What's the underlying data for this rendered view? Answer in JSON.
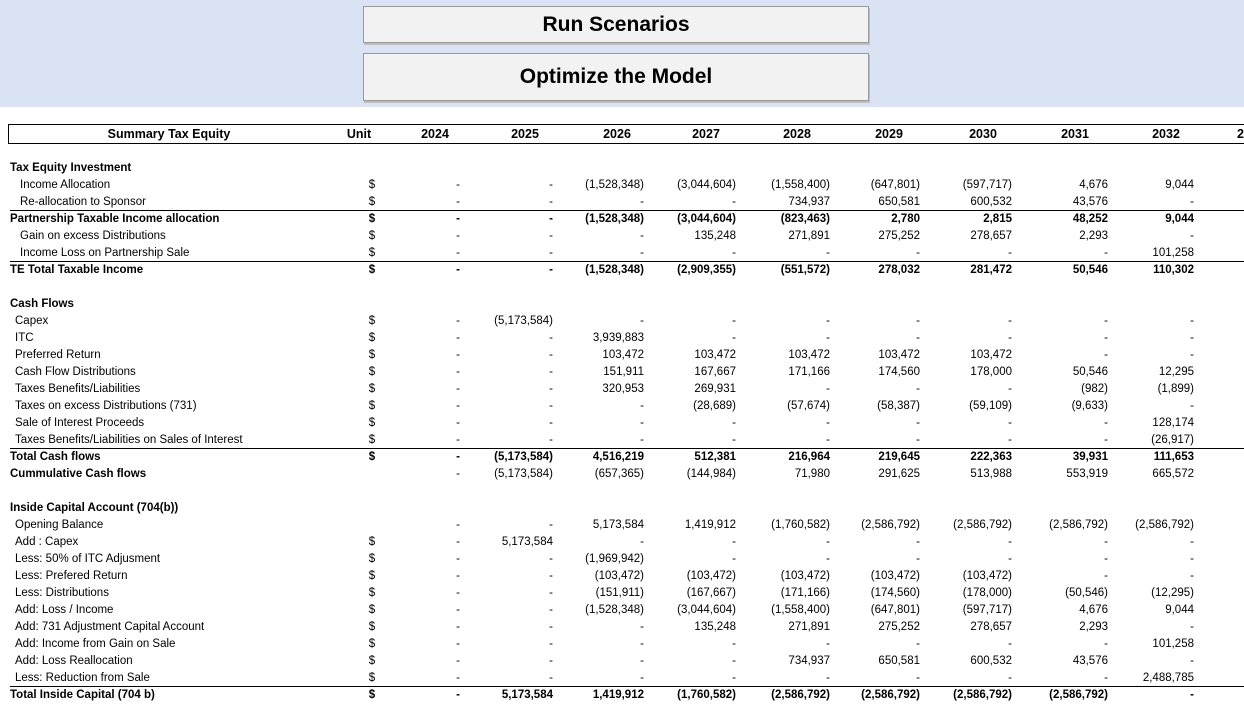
{
  "buttons": {
    "run": "Run Scenarios",
    "optimize": "Optimize the Model"
  },
  "header": {
    "title": "Summary Tax Equity",
    "unit": "Unit",
    "years": [
      "2024",
      "2025",
      "2026",
      "2027",
      "2028",
      "2029",
      "2030",
      "2031",
      "2032"
    ],
    "overflow_char": "2"
  },
  "rows": [
    {
      "label": "Tax Equity Investment",
      "unit": "",
      "vals": [
        "",
        "",
        "",
        "",
        "",
        "",
        "",
        "",
        ""
      ],
      "bold": true,
      "indent": 0
    },
    {
      "label": "Income Allocation",
      "unit": "$",
      "vals": [
        "-",
        "-",
        "(1,528,348)",
        "(3,044,604)",
        "(1,558,400)",
        "(647,801)",
        "(597,717)",
        "4,676",
        "9,044"
      ],
      "indent": 1
    },
    {
      "label": "Re-allocation to Sponsor",
      "unit": "$",
      "vals": [
        "-",
        "-",
        "-",
        "-",
        "734,937",
        "650,581",
        "600,532",
        "43,576",
        "-"
      ],
      "indent": 1
    },
    {
      "label": "Partnership Taxable Income allocation",
      "unit": "$",
      "vals": [
        "-",
        "-",
        "(1,528,348)",
        "(3,044,604)",
        "(823,463)",
        "2,780",
        "2,815",
        "48,252",
        "9,044"
      ],
      "bold": true,
      "line": true,
      "indent": 0
    },
    {
      "label": "Gain on excess Distributions",
      "unit": "$",
      "vals": [
        "-",
        "-",
        "-",
        "135,248",
        "271,891",
        "275,252",
        "278,657",
        "2,293",
        "-"
      ],
      "indent": 1
    },
    {
      "label": "Income Loss on Partnership Sale",
      "unit": "$",
      "vals": [
        "-",
        "-",
        "-",
        "-",
        "-",
        "-",
        "-",
        "-",
        "101,258"
      ],
      "indent": 1
    },
    {
      "label": "TE Total Taxable Income",
      "unit": "$",
      "vals": [
        "-",
        "-",
        "(1,528,348)",
        "(2,909,355)",
        "(551,572)",
        "278,032",
        "281,472",
        "50,546",
        "110,302"
      ],
      "bold": true,
      "line": true,
      "indent": 0
    },
    {
      "label": "",
      "unit": "",
      "vals": [
        "",
        "",
        "",
        "",
        "",
        "",
        "",
        "",
        ""
      ],
      "indent": 0
    },
    {
      "label": "Cash Flows",
      "unit": "",
      "vals": [
        "",
        "",
        "",
        "",
        "",
        "",
        "",
        "",
        ""
      ],
      "bold": true,
      "indent": 0
    },
    {
      "label": "Capex",
      "unit": "$",
      "vals": [
        "-",
        "(5,173,584)",
        "-",
        "-",
        "-",
        "-",
        "-",
        "-",
        "-"
      ],
      "indent": 2
    },
    {
      "label": "ITC",
      "unit": "$",
      "vals": [
        "-",
        "-",
        "3,939,883",
        "-",
        "-",
        "-",
        "-",
        "-",
        "-"
      ],
      "indent": 2
    },
    {
      "label": "Preferred Return",
      "unit": "$",
      "vals": [
        "-",
        "-",
        "103,472",
        "103,472",
        "103,472",
        "103,472",
        "103,472",
        "-",
        "-"
      ],
      "indent": 2
    },
    {
      "label": "Cash Flow Distributions",
      "unit": "$",
      "vals": [
        "-",
        "-",
        "151,911",
        "167,667",
        "171,166",
        "174,560",
        "178,000",
        "50,546",
        "12,295"
      ],
      "indent": 2
    },
    {
      "label": "Taxes Benefits/Liabilities",
      "unit": "$",
      "vals": [
        "-",
        "-",
        "320,953",
        "269,931",
        "-",
        "-",
        "-",
        "(982)",
        "(1,899)"
      ],
      "indent": 2
    },
    {
      "label": "Taxes on excess Distributions (731)",
      "unit": "$",
      "vals": [
        "-",
        "-",
        "-",
        "(28,689)",
        "(57,674)",
        "(58,387)",
        "(59,109)",
        "(9,633)",
        "-"
      ],
      "indent": 2
    },
    {
      "label": "Sale of Interest Proceeds",
      "unit": "$",
      "vals": [
        "-",
        "-",
        "-",
        "-",
        "-",
        "-",
        "-",
        "-",
        "128,174"
      ],
      "indent": 2
    },
    {
      "label": "Taxes Benefits/Liabilities on Sales of Interest",
      "unit": "$",
      "vals": [
        "-",
        "-",
        "-",
        "-",
        "-",
        "-",
        "-",
        "-",
        "(26,917)"
      ],
      "indent": 2
    },
    {
      "label": "Total Cash flows",
      "unit": "$",
      "vals": [
        "-",
        "(5,173,584)",
        "4,516,219",
        "512,381",
        "216,964",
        "219,645",
        "222,363",
        "39,931",
        "111,653"
      ],
      "bold": true,
      "line": true,
      "indent": 0
    },
    {
      "label": "Cummulative Cash flows",
      "unit": "",
      "vals": [
        "-",
        "(5,173,584)",
        "(657,365)",
        "(144,984)",
        "71,980",
        "291,625",
        "513,988",
        "553,919",
        "665,572"
      ],
      "bold_label": true,
      "indent": 0
    },
    {
      "label": "",
      "unit": "",
      "vals": [
        "",
        "",
        "",
        "",
        "",
        "",
        "",
        "",
        ""
      ],
      "indent": 0
    },
    {
      "label": "Inside Capital Account (704(b))",
      "unit": "",
      "vals": [
        "",
        "",
        "",
        "",
        "",
        "",
        "",
        "",
        ""
      ],
      "bold": true,
      "indent": 0
    },
    {
      "label": "Opening Balance",
      "unit": "",
      "vals": [
        "-",
        "-",
        "5,173,584",
        "1,419,912",
        "(1,760,582)",
        "(2,586,792)",
        "(2,586,792)",
        "(2,586,792)",
        "(2,586,792)"
      ],
      "indent": 2
    },
    {
      "label": "Add : Capex",
      "unit": "$",
      "vals": [
        "-",
        "5,173,584",
        "-",
        "-",
        "-",
        "-",
        "-",
        "-",
        "-"
      ],
      "indent": 2
    },
    {
      "label": "Less: 50% of ITC Adjusment",
      "unit": "$",
      "vals": [
        "-",
        "-",
        "(1,969,942)",
        "-",
        "-",
        "-",
        "-",
        "-",
        "-"
      ],
      "indent": 2
    },
    {
      "label": "Less: Prefered Return",
      "unit": "$",
      "vals": [
        "-",
        "-",
        "(103,472)",
        "(103,472)",
        "(103,472)",
        "(103,472)",
        "(103,472)",
        "-",
        "-"
      ],
      "indent": 2
    },
    {
      "label": "Less: Distributions",
      "unit": "$",
      "vals": [
        "-",
        "-",
        "(151,911)",
        "(167,667)",
        "(171,166)",
        "(174,560)",
        "(178,000)",
        "(50,546)",
        "(12,295)"
      ],
      "indent": 2
    },
    {
      "label": "Add: Loss / Income",
      "unit": "$",
      "vals": [
        "-",
        "-",
        "(1,528,348)",
        "(3,044,604)",
        "(1,558,400)",
        "(647,801)",
        "(597,717)",
        "4,676",
        "9,044"
      ],
      "indent": 2
    },
    {
      "label": "Add: 731 Adjustment Capital Account",
      "unit": "$",
      "vals": [
        "-",
        "-",
        "-",
        "135,248",
        "271,891",
        "275,252",
        "278,657",
        "2,293",
        "-"
      ],
      "indent": 2
    },
    {
      "label": "Add: Income from Gain on Sale",
      "unit": "$",
      "vals": [
        "-",
        "-",
        "-",
        "-",
        "-",
        "-",
        "-",
        "-",
        "101,258"
      ],
      "indent": 2
    },
    {
      "label": "Add: Loss Reallocation",
      "unit": "$",
      "vals": [
        "-",
        "-",
        "-",
        "-",
        "734,937",
        "650,581",
        "600,532",
        "43,576",
        "-"
      ],
      "indent": 2
    },
    {
      "label": "Less: Reduction from Sale",
      "unit": "$",
      "vals": [
        "-",
        "-",
        "-",
        "-",
        "-",
        "-",
        "-",
        "-",
        "2,488,785"
      ],
      "indent": 2
    },
    {
      "label": "Total Inside Capital (704 b)",
      "unit": "$",
      "vals": [
        "-",
        "5,173,584",
        "1,419,912",
        "(1,760,582)",
        "(2,586,792)",
        "(2,586,792)",
        "(2,586,792)",
        "(2,586,792)",
        "-"
      ],
      "bold": true,
      "line": true,
      "indent": 0
    }
  ]
}
